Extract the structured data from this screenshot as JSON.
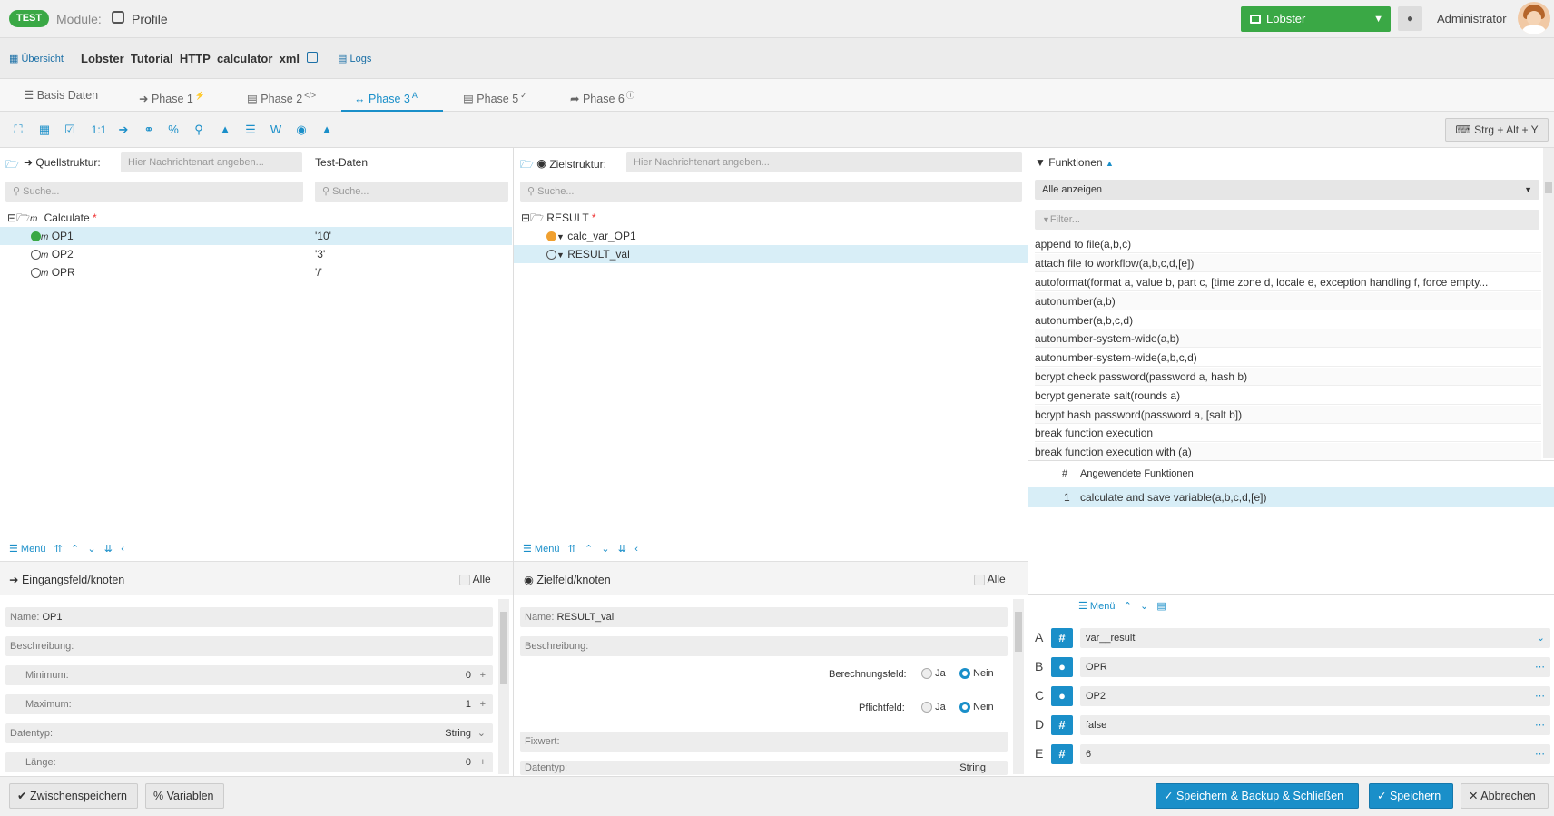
{
  "header": {
    "env_badge": "TEST",
    "module_label": "Module:",
    "module_name": "Profile",
    "lobster_dd": "Lobster",
    "user": "Administrator"
  },
  "subbar": {
    "overview": "Übersicht",
    "profile_name": "Lobster_Tutorial_HTTP_calculator_xml",
    "logs": "Logs"
  },
  "tabs": [
    {
      "label": "Basis Daten"
    },
    {
      "label": "Phase 1"
    },
    {
      "label": "Phase 2"
    },
    {
      "label": "Phase 3"
    },
    {
      "label": "Phase 5"
    },
    {
      "label": "Phase 6"
    }
  ],
  "toolbar": {
    "one_to_one": "1:1",
    "shortcut": "Strg + Alt + Y"
  },
  "source": {
    "label": "Quellstruktur:",
    "msg_placeholder": "Hier Nachrichtenart angeben...",
    "testdata_label": "Test-Daten",
    "search_placeholder": "Suche...",
    "search2_placeholder": "Suche...",
    "root": "Calculate",
    "nodes": [
      {
        "name": "OP1",
        "value": "'10'"
      },
      {
        "name": "OP2",
        "value": "'3'"
      },
      {
        "name": "OPR",
        "value": "'/'"
      }
    ]
  },
  "target": {
    "label": "Zielstruktur:",
    "msg_placeholder": "Hier Nachrichtenart angeben...",
    "search_placeholder": "Suche...",
    "root": "RESULT",
    "nodes": [
      {
        "name": "calc_var_OP1"
      },
      {
        "name": "RESULT_val"
      }
    ]
  },
  "functions": {
    "title": "Funktionen",
    "filter_select": "Alle anzeigen",
    "filter_placeholder": "Filter...",
    "items": [
      "append to file(a,b,c)",
      "attach file to workflow(a,b,c,d,[e])",
      "autoformat(format a, value b, part c, [time zone d, locale e, exception handling f, force empty...",
      "autonumber(a,b)",
      "autonumber(a,b,c,d)",
      "autonumber-system-wide(a,b)",
      "autonumber-system-wide(a,b,c,d)",
      "bcrypt check password(password a, hash b)",
      "bcrypt generate salt(rounds a)",
      "bcrypt hash password(password a, [salt b])",
      "break function execution",
      "break function execution with (a)"
    ],
    "applied_hash": "#",
    "applied_header": "Angewendete Funktionen",
    "applied": [
      {
        "num": "1",
        "name": "calculate and save variable(a,b,c,d,[e])"
      }
    ]
  },
  "menus": {
    "menu": "Menü"
  },
  "input_panel": {
    "title": "Eingangsfeld/knoten",
    "all": "Alle",
    "name_label": "Name:",
    "name_value": "OP1",
    "desc_label": "Beschreibung:",
    "min_label": "Minimum:",
    "min_value": "0",
    "max_label": "Maximum:",
    "max_value": "1",
    "type_label": "Datentyp:",
    "type_value": "String",
    "len_label": "Länge:",
    "len_value": "0"
  },
  "output_panel": {
    "title": "Zielfeld/knoten",
    "all": "Alle",
    "name_label": "Name:",
    "name_value": "RESULT_val",
    "desc_label": "Beschreibung:",
    "calc_label": "Berechnungsfeld:",
    "req_label": "Pflichtfeld:",
    "yes": "Ja",
    "no": "Nein",
    "fixed_label": "Fixwert:",
    "type_label": "Datentyp:",
    "type_value": "String"
  },
  "params": [
    {
      "letter": "A",
      "icon": "#",
      "value": "var__result"
    },
    {
      "letter": "B",
      "icon": "●",
      "value": "OPR"
    },
    {
      "letter": "C",
      "icon": "●",
      "value": "OP2"
    },
    {
      "letter": "D",
      "icon": "#",
      "value": "false"
    },
    {
      "letter": "E",
      "icon": "#",
      "value": "6"
    }
  ],
  "footer": {
    "save_temp": "Zwischenspeichern",
    "variables": "Variablen",
    "save_backup_close": "Speichern & Backup & Schließen",
    "save": "Speichern",
    "cancel": "Abbrechen"
  }
}
